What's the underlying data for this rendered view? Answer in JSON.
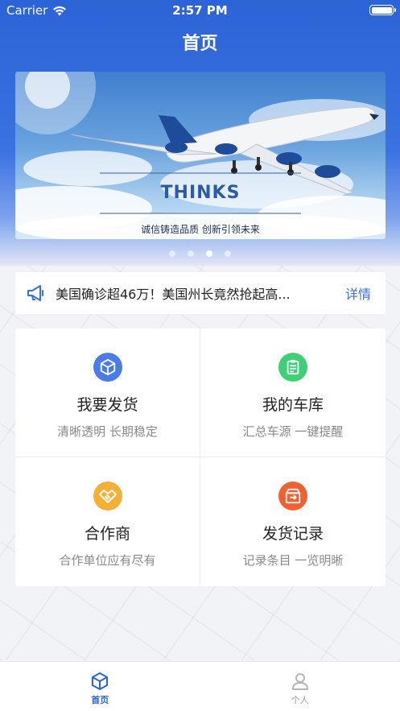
{
  "status_bar": {
    "carrier": "Carrier",
    "time": "2:57 PM"
  },
  "header": {
    "title": "首页"
  },
  "banner": {
    "brand": "THINKS",
    "slogan": "诚信铸造品质 创新引领未来",
    "page_count": 4,
    "active_index": 2
  },
  "notice": {
    "text": "美国确诊超46万！美国州长竟然抢起高...",
    "more_label": "详情"
  },
  "features": [
    {
      "title": "我要发货",
      "subtitle": "清晰透明 长期稳定",
      "icon": "box-icon",
      "color": "#4a7be6"
    },
    {
      "title": "我的车库",
      "subtitle": "汇总车源 一键提醒",
      "icon": "clipboard-icon",
      "color": "#3fcf77"
    },
    {
      "title": "合作商",
      "subtitle": "合作单位应有尽有",
      "icon": "handshake-icon",
      "color": "#f3b036"
    },
    {
      "title": "发货记录",
      "subtitle": "记录条目 一览明晰",
      "icon": "record-box-icon",
      "color": "#f06030"
    }
  ],
  "tabbar": {
    "items": [
      {
        "label": "首页",
        "icon": "cube-icon",
        "active": true
      },
      {
        "label": "个人",
        "icon": "person-icon",
        "active": false
      }
    ]
  },
  "colors": {
    "primary": "#2c63d6",
    "accent_link": "#3a6fd8"
  }
}
